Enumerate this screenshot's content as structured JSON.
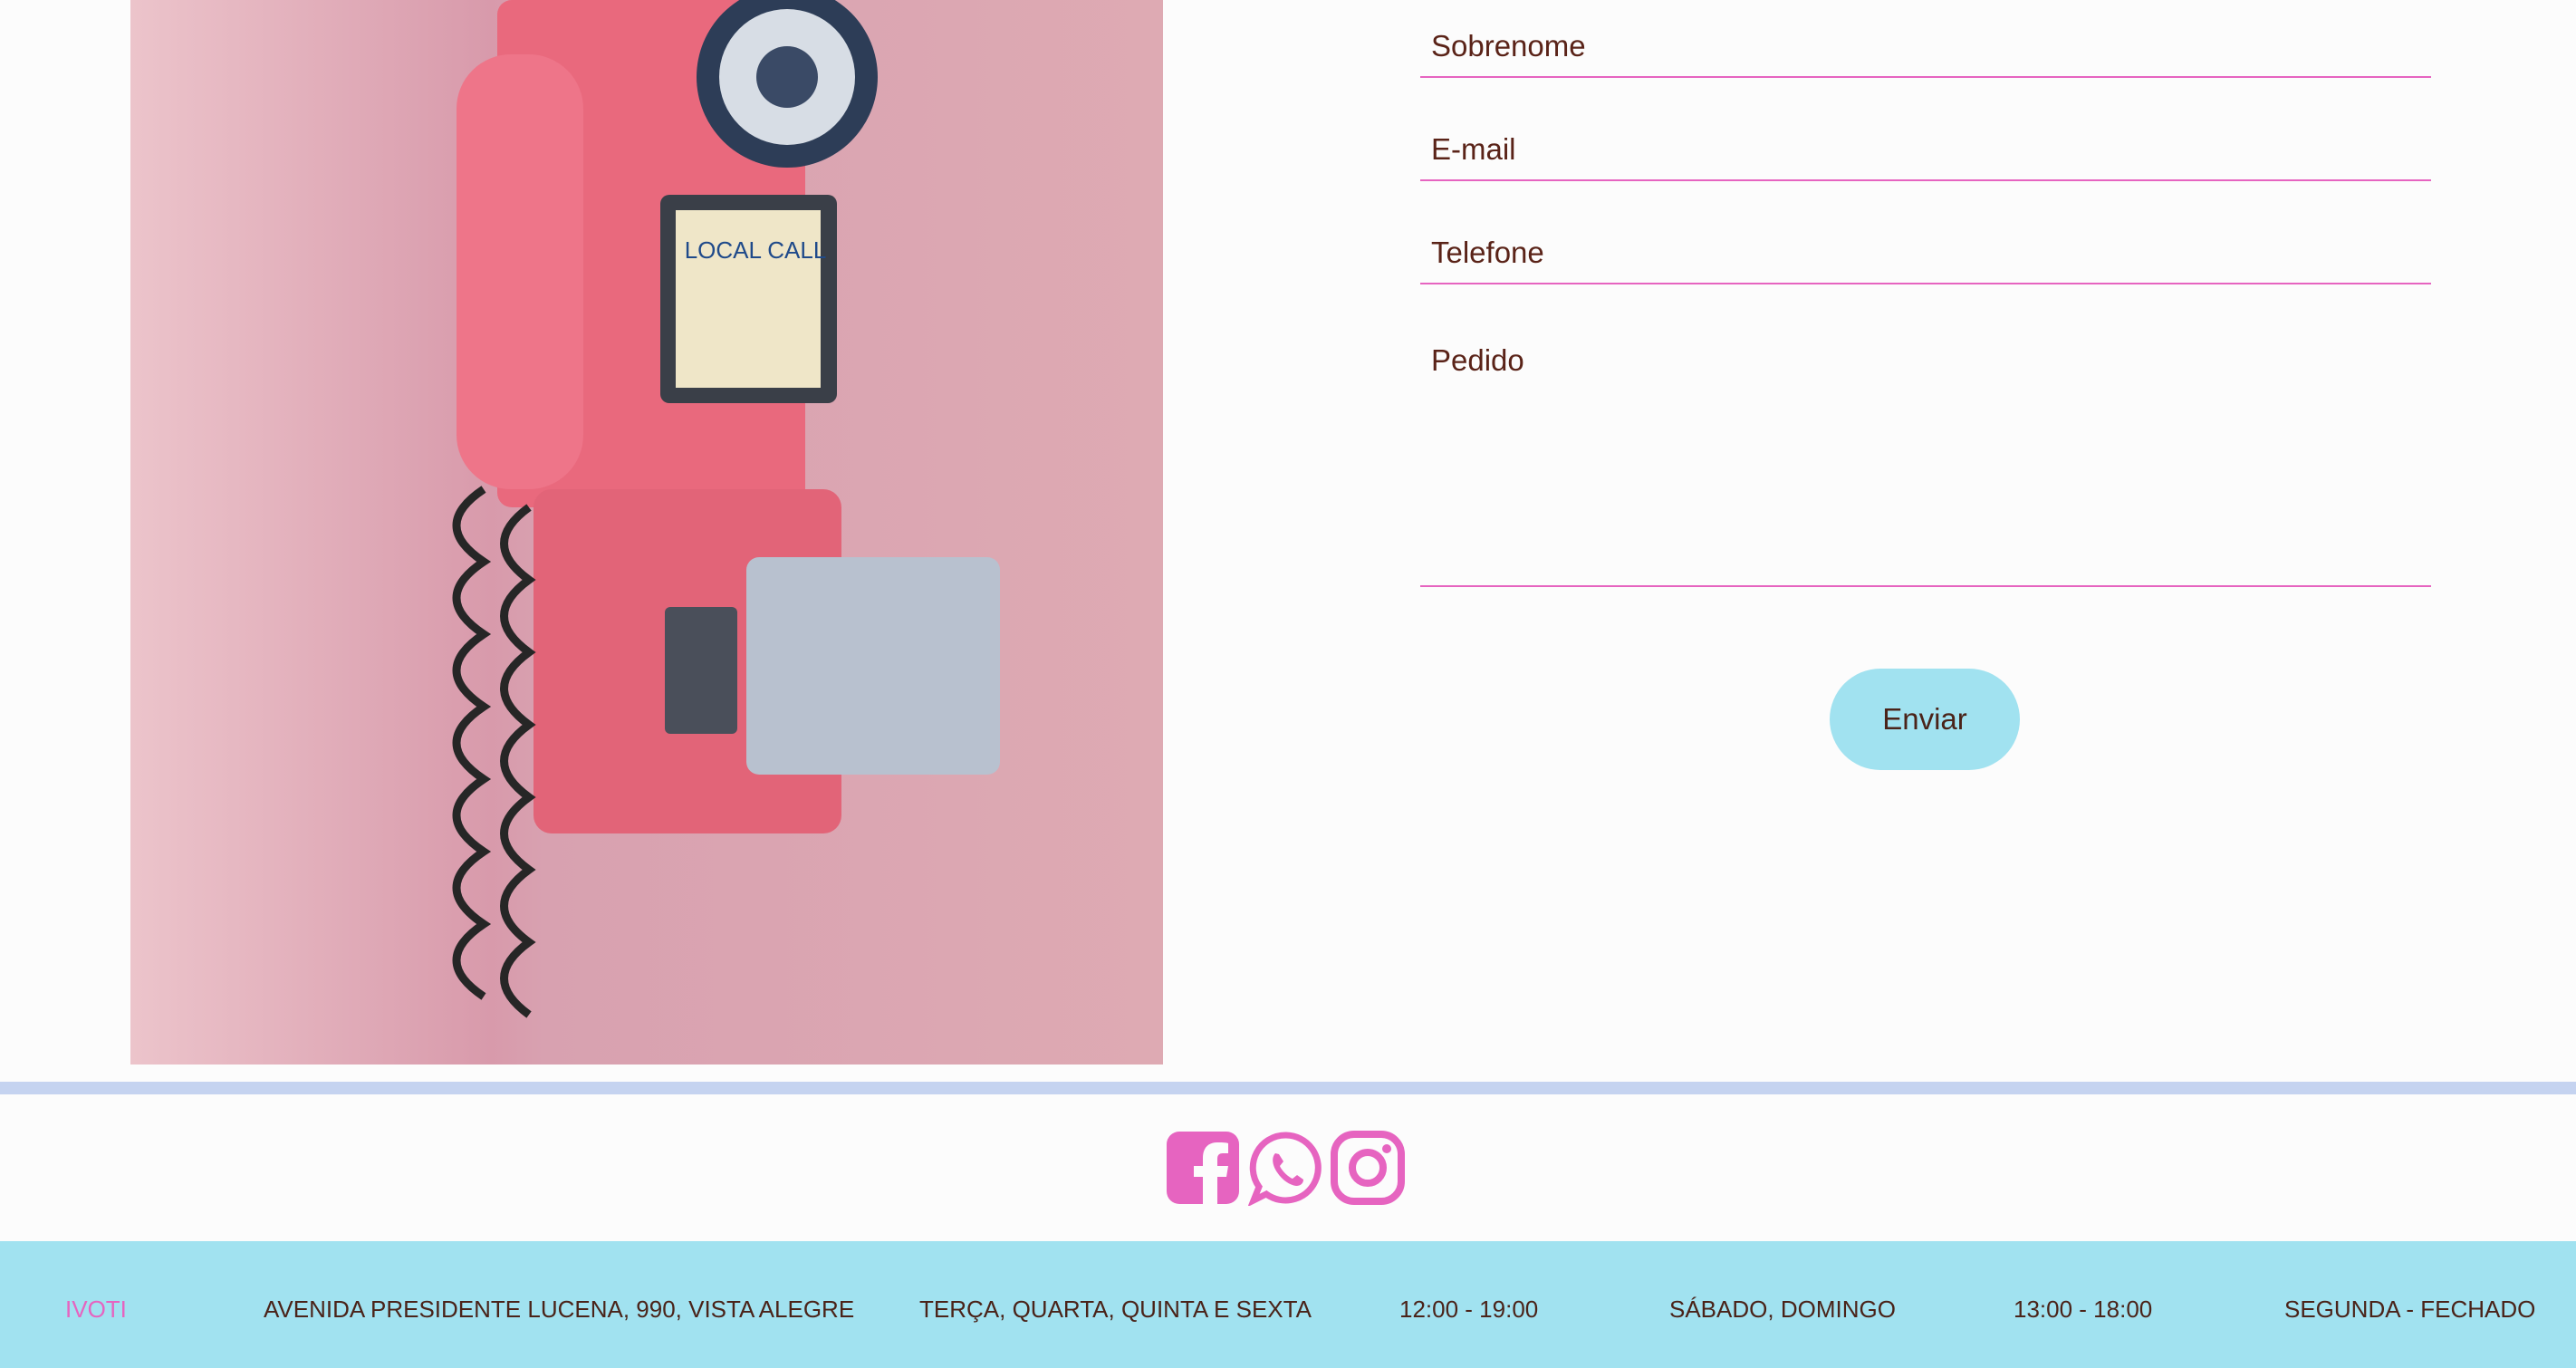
{
  "form": {
    "fields": [
      {
        "label": "Sobrenome"
      },
      {
        "label": "E-mail"
      },
      {
        "label": "Telefone"
      },
      {
        "label": "Pedido"
      }
    ],
    "submit_label": "Enviar"
  },
  "photo": {
    "icon": "pink-payphone-photo"
  },
  "social": [
    {
      "icon": "facebook-icon"
    },
    {
      "icon": "whatsapp-icon"
    },
    {
      "icon": "instagram-icon"
    }
  ],
  "footer": {
    "city": "IVOTI",
    "address": "AVENIDA PRESIDENTE LUCENA, 990, VISTA ALEGRE",
    "weekdays": "TERÇA, QUARTA, QUINTA E SEXTA",
    "weekday_hours": "12:00 - 19:00",
    "weekend": "SÁBADO, DOMINGO",
    "weekend_hours": "13:00 - 18:00",
    "closed": "SEGUNDA - FECHADO"
  },
  "colors": {
    "accent": "#e664c0",
    "button": "#a1e2f0",
    "footer_bg": "#a1e2f0",
    "divider": "#c5d3f0",
    "text": "#5a2318"
  }
}
